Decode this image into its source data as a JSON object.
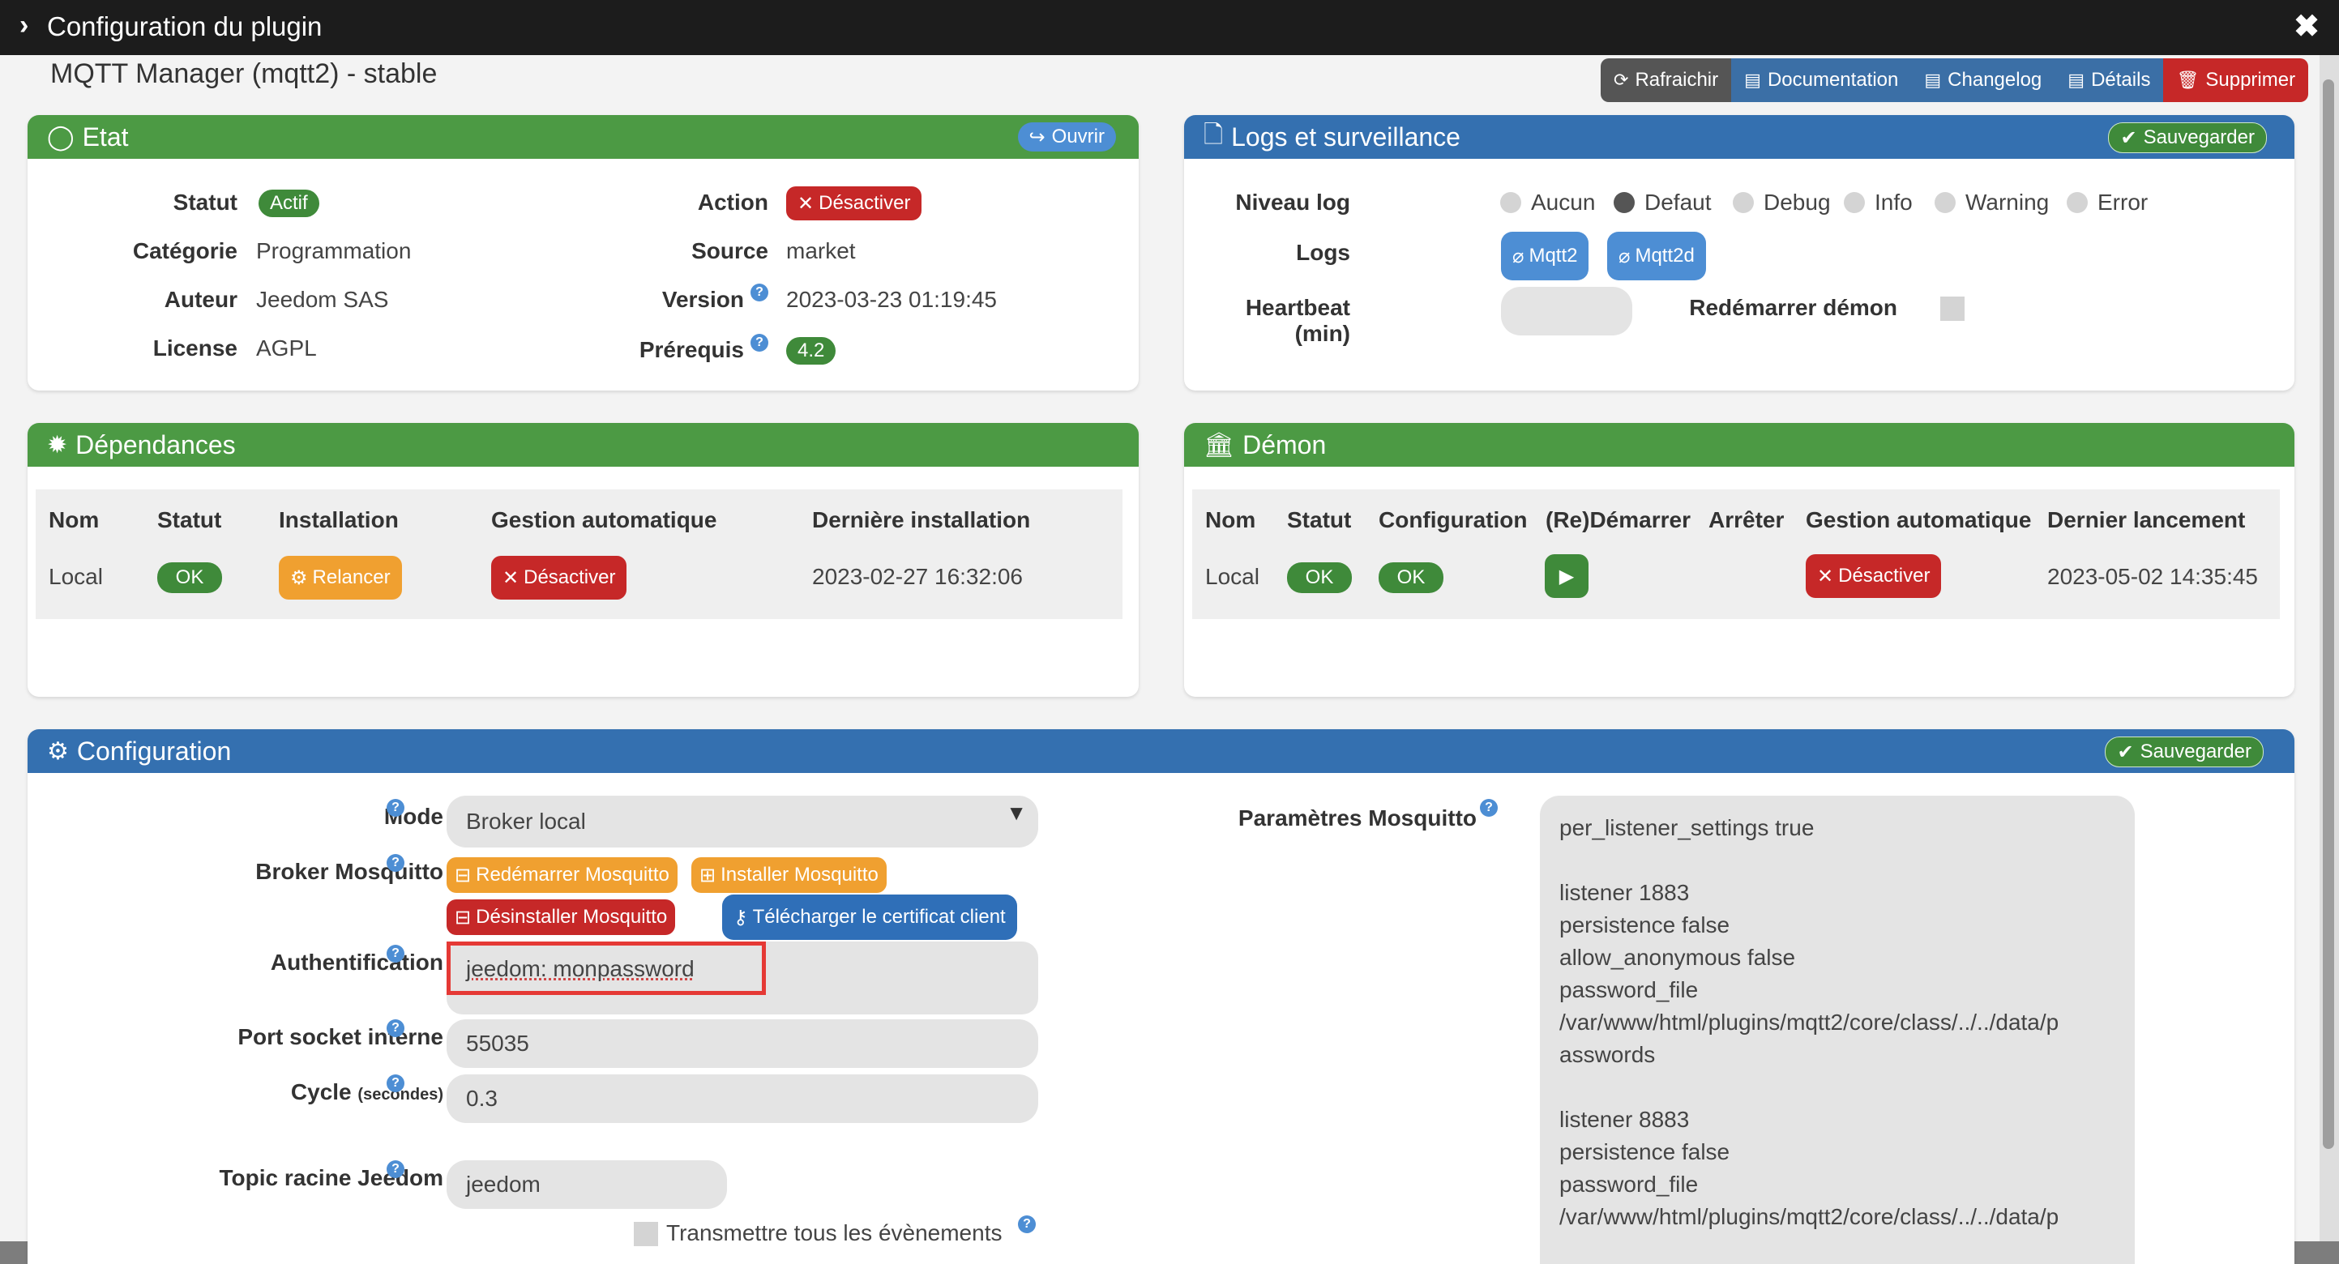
{
  "window": {
    "title": "Configuration du plugin",
    "close": "✖"
  },
  "plugin": {
    "name": "MQTT Manager (mqtt2) - stable"
  },
  "toolbar": {
    "refresh": "Rafraichir",
    "documentation": "Documentation",
    "changelog": "Changelog",
    "details": "Détails",
    "delete": "Supprimer"
  },
  "etat": {
    "title": "Etat",
    "open_btn": "Ouvrir",
    "statut_label": "Statut",
    "statut_value": "Actif",
    "categorie_label": "Catégorie",
    "categorie_value": "Programmation",
    "auteur_label": "Auteur",
    "auteur_value": "Jeedom SAS",
    "license_label": "License",
    "license_value": "AGPL",
    "action_label": "Action",
    "action_btn": "Désactiver",
    "source_label": "Source",
    "source_value": "market",
    "version_label": "Version",
    "version_value": "2023-03-23 01:19:45",
    "prerequis_label": "Prérequis",
    "prerequis_value": "4.2"
  },
  "logs": {
    "title": "Logs et surveillance",
    "save_btn": "Sauvegarder",
    "niveau_label": "Niveau log",
    "levels": [
      "Aucun",
      "Defaut",
      "Debug",
      "Info",
      "Warning",
      "Error"
    ],
    "selected_level": "Defaut",
    "logs_label": "Logs",
    "log_files": [
      "Mqtt2",
      "Mqtt2d"
    ],
    "heartbeat_label": "Heartbeat (min)",
    "heartbeat_value": "",
    "restart_label": "Redémarrer démon"
  },
  "deps": {
    "title": "Dépendances",
    "headers": [
      "Nom",
      "Statut",
      "Installation",
      "Gestion automatique",
      "Dernière installation"
    ],
    "row": {
      "nom": "Local",
      "statut": "OK",
      "installation": "Relancer",
      "gestion": "Désactiver",
      "derniere": "2023-02-27 16:32:06"
    }
  },
  "demon": {
    "title": "Démon",
    "headers": [
      "Nom",
      "Statut",
      "Configuration",
      "(Re)Démarrer",
      "Arrêter",
      "Gestion automatique",
      "Dernier lancement"
    ],
    "row": {
      "nom": "Local",
      "statut": "OK",
      "configuration": "OK",
      "gestion": "Désactiver",
      "dernier": "2023-05-02 14:35:45"
    }
  },
  "config": {
    "title": "Configuration",
    "save_btn": "Sauvegarder",
    "mode_label": "Mode",
    "mode_value": "Broker local",
    "broker_label": "Broker Mosquitto",
    "btn_restart": "Redémarrer Mosquitto",
    "btn_install": "Installer Mosquitto",
    "btn_uninstall": "Désinstaller Mosquitto",
    "btn_cert": "Télécharger le certificat client",
    "auth_label": "Authentification",
    "auth_value": "jeedom: monpassword",
    "port_label": "Port socket interne",
    "port_value": "55035",
    "cycle_label": "Cycle",
    "cycle_unit": "(secondes)",
    "cycle_value": "0.3",
    "topic_label": "Topic racine Jeedom",
    "topic_value": "jeedom",
    "transmit_label": "Transmettre tous les évènements",
    "params_label": "Paramètres Mosquitto",
    "params_value": "per_listener_settings true\n\nlistener 1883\npersistence false\nallow_anonymous false\npassword_file\n/var/www/html/plugins/mqtt2/core/class/../../data/p\nasswords\n\nlistener 8883\npersistence false\npassword_file\n/var/www/html/plugins/mqtt2/core/class/../../data/p"
  }
}
